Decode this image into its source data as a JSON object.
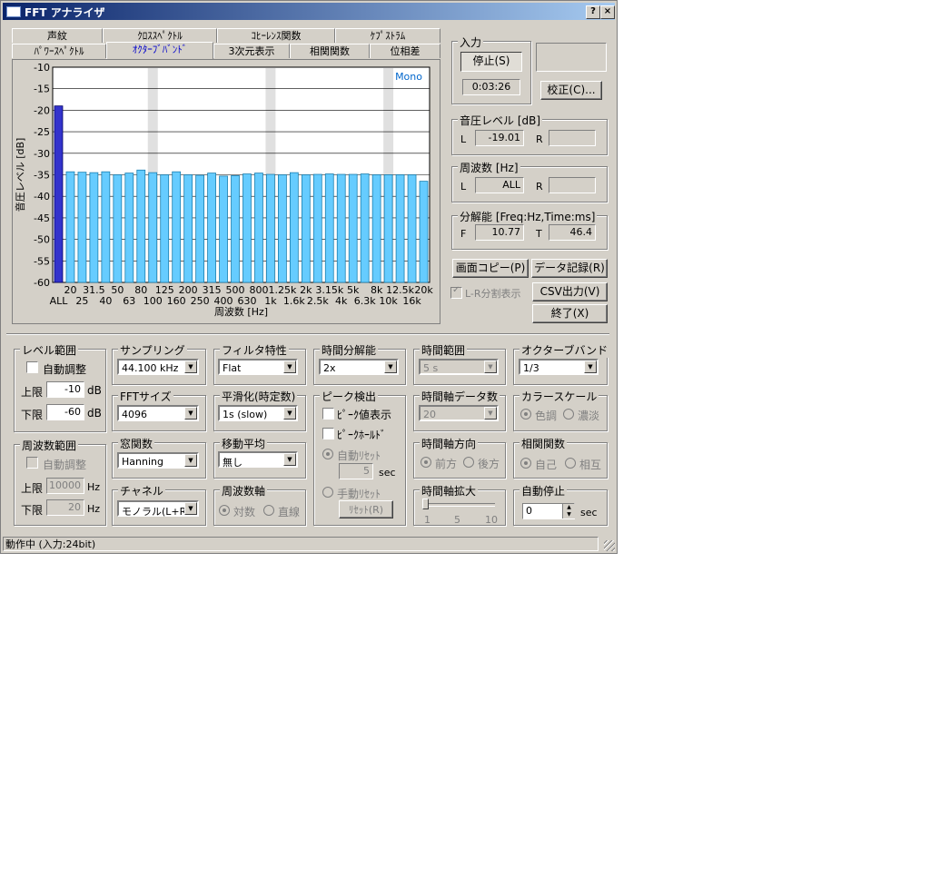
{
  "window": {
    "title": "FFT アナライザ",
    "help_btn": "?",
    "close_btn": "×"
  },
  "tabs": {
    "row1": [
      "声紋",
      "ｸﾛｽｽﾍﾟｸﾄﾙ",
      "ｺﾋｰﾚﾝｽ関数",
      "ｹﾌﾟｽﾄﾗﾑ"
    ],
    "row2": [
      "ﾊﾟﾜｰｽﾍﾟｸﾄﾙ",
      "ｵｸﾀｰﾌﾞﾊﾞﾝﾄﾞ",
      "3次元表示",
      "相関関数",
      "位相差"
    ]
  },
  "chart_data": {
    "type": "bar",
    "badge": "Mono",
    "xlabel": "周波数 [Hz]",
    "ylabel": "音圧レベル [dB]",
    "ylim": [
      -60,
      -10
    ],
    "yticks": [
      -10,
      -15,
      -20,
      -25,
      -30,
      -35,
      -40,
      -45,
      -50,
      -55,
      -60
    ],
    "categories": [
      "ALL",
      "20",
      "25",
      "31.5",
      "40",
      "50",
      "63",
      "80",
      "100",
      "125",
      "160",
      "200",
      "250",
      "315",
      "400",
      "500",
      "630",
      "800",
      "1k",
      "1.25k",
      "1.6k",
      "2k",
      "2.5k",
      "3.15k",
      "4k",
      "5k",
      "6.3k",
      "8k",
      "10k",
      "12.5k",
      "16k",
      "20k"
    ],
    "tick_labels_top": [
      "20",
      "31.5",
      "50",
      "80",
      "125",
      "200",
      "315",
      "500",
      "800",
      "1.25k",
      "2k",
      "3.15k",
      "5k",
      "8k",
      "12.5k",
      "20k"
    ],
    "tick_labels_bottom": [
      "ALL",
      "25",
      "40",
      "63",
      "100",
      "160",
      "250",
      "400",
      "630",
      "1k",
      "1.6k",
      "2.5k",
      "4k",
      "6.3k",
      "10k",
      "16k"
    ],
    "values": [
      -19.0,
      -34.3,
      -34.4,
      -34.5,
      -34.3,
      -35.0,
      -34.6,
      -33.9,
      -34.5,
      -35.0,
      -34.3,
      -35.0,
      -35.1,
      -34.6,
      -35.3,
      -35.2,
      -34.8,
      -34.6,
      -34.9,
      -35.0,
      -34.5,
      -35.0,
      -34.9,
      -34.8,
      -34.9,
      -34.9,
      -34.8,
      -35.0,
      -35.0,
      -35.0,
      -35.0,
      -36.5
    ],
    "highlight_color": "#3333cc",
    "bar_color": "#66ccff",
    "shaded_columns": [
      "100",
      "1k",
      "10k"
    ],
    "grid": true
  },
  "input": {
    "group_label": "入力",
    "stop_label": "停止(S)",
    "elapsed": "0:03:26",
    "calibrate_label": "校正(C)..."
  },
  "level": {
    "group_label": "音圧レベル [dB]",
    "l_label": "L",
    "l_value": "-19.01",
    "r_label": "R",
    "r_value": ""
  },
  "freq": {
    "group_label": "周波数 [Hz]",
    "l_label": "L",
    "l_value": "ALL",
    "r_label": "R",
    "r_value": ""
  },
  "resolution": {
    "group_label": "分解能 [Freq:Hz,Time:ms]",
    "f_label": "F",
    "f_value": "10.77",
    "t_label": "T",
    "t_value": "46.4"
  },
  "actions": {
    "screen_copy": "画面コピー(P)",
    "data_record": "データ記録(R)",
    "lr_split": "L-R分割表示",
    "csv": "CSV出力(V)",
    "exit": "終了(X)"
  },
  "level_range": {
    "group_label": "レベル範囲",
    "auto": "自動調整",
    "upper_label": "上限",
    "upper_value": "-10",
    "lower_label": "下限",
    "lower_value": "-60",
    "unit": "dB"
  },
  "freq_range": {
    "group_label": "周波数範囲",
    "auto": "自動調整",
    "upper_label": "上限",
    "upper_value": "10000",
    "lower_label": "下限",
    "lower_value": "20",
    "unit": "Hz"
  },
  "sampling": {
    "group_label": "サンプリング",
    "value": "44.100 kHz"
  },
  "fft_size": {
    "group_label": "FFTサイズ",
    "value": "4096"
  },
  "window_fn": {
    "group_label": "窓関数",
    "value": "Hanning"
  },
  "channel": {
    "group_label": "チャネル",
    "value": "モノラル(L+R)"
  },
  "filter": {
    "group_label": "フィルタ特性",
    "value": "Flat"
  },
  "smoothing": {
    "group_label": "平滑化(時定数)",
    "value": "1s (slow)"
  },
  "moving_avg": {
    "group_label": "移動平均",
    "value": "無し"
  },
  "freq_axis": {
    "group_label": "周波数軸",
    "opt1": "対数",
    "opt2": "直線"
  },
  "time_res": {
    "group_label": "時間分解能",
    "value": "2x"
  },
  "peak": {
    "group_label": "ピーク検出",
    "show_value": "ﾋﾟｰｸ値表示",
    "hold": "ﾋﾟｰｸﾎｰﾙﾄﾞ",
    "auto_reset": "自動ﾘｾｯﾄ",
    "auto_value": "5",
    "auto_unit": "sec",
    "manual_reset": "手動ﾘｾｯﾄ",
    "reset_btn": "ﾘｾｯﾄ(R)"
  },
  "time_range": {
    "group_label": "時間範囲",
    "value": "5 s"
  },
  "time_data_count": {
    "group_label": "時間軸データ数",
    "value": "20"
  },
  "time_dir": {
    "group_label": "時間軸方向",
    "opt1": "前方",
    "opt2": "後方"
  },
  "time_zoom": {
    "group_label": "時間軸拡大",
    "min": "1",
    "mid": "5",
    "max": "10"
  },
  "octave_band": {
    "group_label": "オクターブバンド",
    "value": "1/3"
  },
  "color_scale": {
    "group_label": "カラースケール",
    "opt1": "色調",
    "opt2": "濃淡"
  },
  "correlation": {
    "group_label": "相関関数",
    "opt1": "自己",
    "opt2": "相互"
  },
  "auto_stop": {
    "group_label": "自動停止",
    "value": "0",
    "unit": "sec"
  },
  "status": {
    "text": "動作中 (入力:24bit)"
  }
}
